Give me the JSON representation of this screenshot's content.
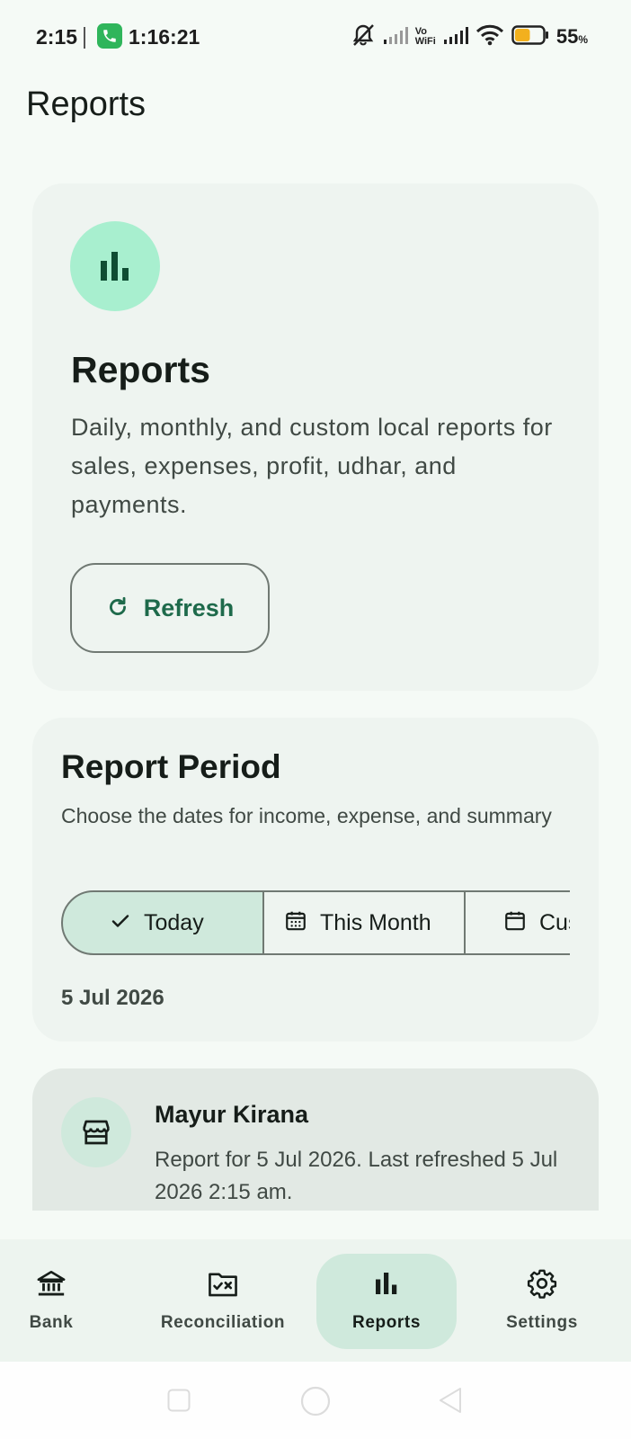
{
  "status_bar": {
    "time": "2:15",
    "call_timer": "1:16:21",
    "vowifi_top": "Vo",
    "vowifi_bottom": "WiFi",
    "battery_percent": "55",
    "battery_unit": "%",
    "battery_level": 0.55
  },
  "page": {
    "title": "Reports"
  },
  "hero_card": {
    "title": "Reports",
    "description": "Daily, monthly, and custom local reports for sales, expenses, profit, udhar, and payments.",
    "refresh_label": "Refresh"
  },
  "period_card": {
    "title": "Report Period",
    "description": "Choose the dates for income, expense, and summary",
    "segments": [
      {
        "label": "Today",
        "selected": true
      },
      {
        "label": "This Month",
        "selected": false
      },
      {
        "label": "Custom",
        "selected": false
      }
    ],
    "selected_date": "5 Jul 2026"
  },
  "shop_card": {
    "name": "Mayur Kirana",
    "description": "Report for 5 Jul 2026. Last refreshed 5 Jul 2026 2:15 am."
  },
  "bottom_nav": {
    "items": [
      {
        "label": "Bank",
        "icon": "bank-icon"
      },
      {
        "label": "Reconciliation",
        "icon": "reconciliation-icon"
      },
      {
        "label": "Reports",
        "icon": "bar-chart-icon",
        "active": true
      },
      {
        "label": "Settings",
        "icon": "gear-icon"
      }
    ]
  },
  "colors": {
    "accent": "#1e6a4b",
    "selected_container": "#cfe9dc",
    "icon_container": "#a8efcf",
    "background": "#f5faf6"
  }
}
